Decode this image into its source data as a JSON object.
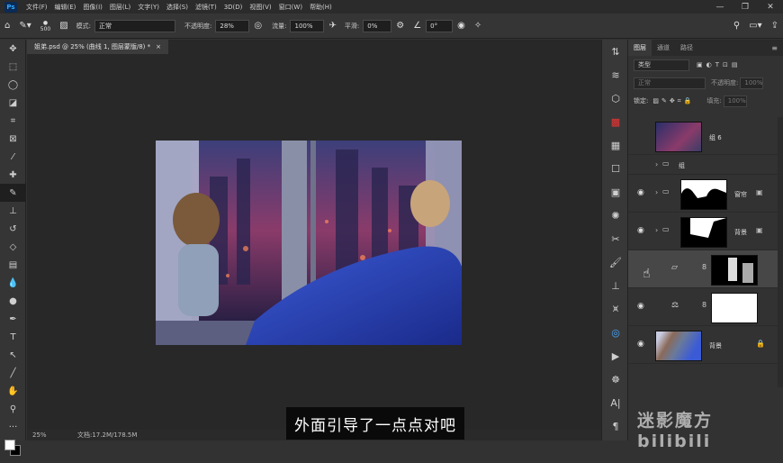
{
  "app": {
    "logo": "Ps"
  },
  "menubar": {
    "items": [
      "文件(F)",
      "编辑(E)",
      "图像(I)",
      "图层(L)",
      "文字(Y)",
      "选择(S)",
      "滤镜(T)",
      "3D(D)",
      "视图(V)",
      "窗口(W)",
      "帮助(H)"
    ]
  },
  "options": {
    "brush_size": "500",
    "mode_label": "模式:",
    "mode_value": "正常",
    "opacity_label": "不透明度:",
    "opacity_value": "28%",
    "flow_label": "流量:",
    "flow_value": "100%",
    "smooth_label": "平滑:",
    "smooth_value": "0%",
    "angle_value": "0°"
  },
  "document": {
    "tab_title": "姐弟.psd @ 25% (曲线 1, 图层蒙版/8) *",
    "close": "×"
  },
  "status": {
    "zoom": "25%",
    "doc_size": "文档:17.2M/178.5M"
  },
  "panel": {
    "tabs": [
      "图层",
      "通道",
      "路径"
    ],
    "filter_label": "类型",
    "blend_mode": "正常",
    "opacity_label": "不透明度:",
    "opacity_value": "100%",
    "lock_label": "锁定:",
    "fill_label": "填充:",
    "fill_value": "100%",
    "layers": [
      {
        "name": "组 6"
      },
      {
        "name": "组"
      },
      {
        "name": "窗帘"
      },
      {
        "name": "背景"
      },
      {
        "name": ""
      },
      {
        "name": ""
      },
      {
        "name": "背景"
      }
    ]
  },
  "subtitle": "外面引导了一点点对吧",
  "watermark": "迷影魔方 bilibili",
  "colors": {
    "accent": "#31a8ff",
    "bg": "#323232",
    "canvas": "#282828"
  }
}
